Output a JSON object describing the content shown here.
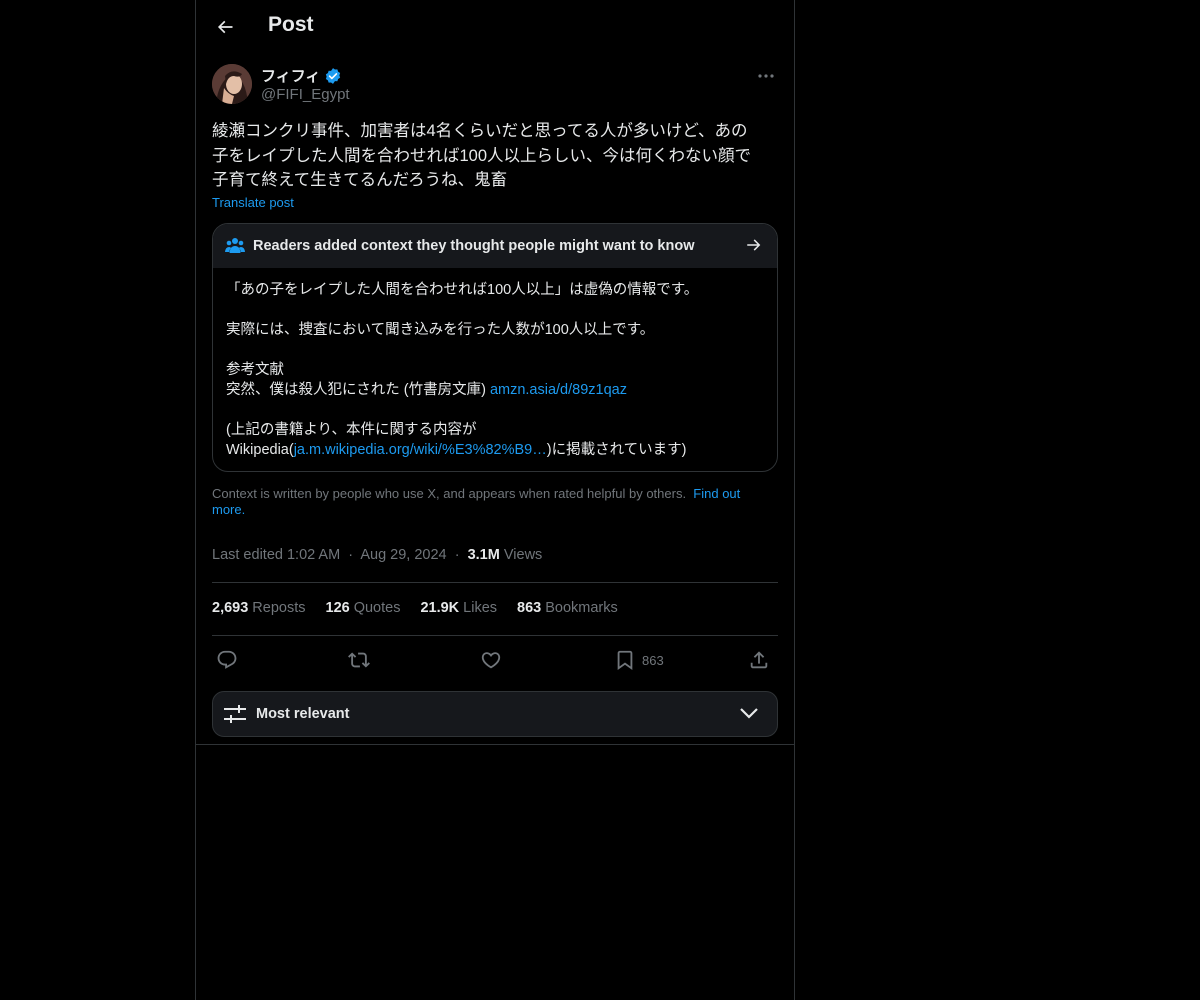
{
  "header": {
    "title": "Post"
  },
  "author": {
    "name": "フィフィ",
    "handle": "@FIFI_Egypt"
  },
  "post": {
    "lines": [
      "綾瀬コンクリ事件、加害者は4名くらいだと思ってる人が多いけど、あの",
      "子をレイプした人間を合わせれば100人以上らしい、今は何くわない顔で",
      "子育て終えて生きてるんだろうね、鬼畜"
    ],
    "translate_label": "Translate post"
  },
  "note": {
    "title": "Readers added context they thought people might want to know",
    "line1": "「あの子をレイプした人間を合わせれば100人以上」は虚偽の情報です。",
    "line2": "実際には、捜査において聞き込みを行った人数が100人以上です。",
    "ref_heading": "参考文献",
    "ref_text": "突然、僕は殺人犯にされた (竹書房文庫) ",
    "ref_link": "amzn.asia/d/89z1qaz",
    "source_line1": "(上記の書籍より、本件に関する内容が",
    "source_prefix": "Wikipedia(",
    "source_link": "ja.m.wikipedia.org/wiki/%E3%82%B9…",
    "source_suffix": ")に掲載されています)"
  },
  "context": {
    "text": "Context is written by people who use X, and appears when rated helpful by others.",
    "link": "Find out more."
  },
  "meta": {
    "edited": "Last edited 1:02 AM",
    "sep": "·",
    "date": "Aug 29, 2024",
    "views_count": "3.1M",
    "views_label": "Views"
  },
  "stats": {
    "reposts_count": "2,693",
    "reposts_label": "Reposts",
    "quotes_count": "126",
    "quotes_label": "Quotes",
    "likes_count": "21.9K",
    "likes_label": "Likes",
    "bookmarks_count": "863",
    "bookmarks_label": "Bookmarks"
  },
  "actions": {
    "reply_icon": "reply-icon",
    "repost_icon": "repost-icon",
    "like_icon": "heart-icon",
    "bookmark_icon": "bookmark-icon",
    "bookmark_count": "863",
    "share_icon": "share-icon"
  },
  "sort": {
    "label": "Most relevant"
  },
  "colors": {
    "background": "#000000",
    "text": "#e7e9ea",
    "muted": "#71767b",
    "accent": "#1d9bf0",
    "border": "#2f3336",
    "card": "#16181c"
  }
}
